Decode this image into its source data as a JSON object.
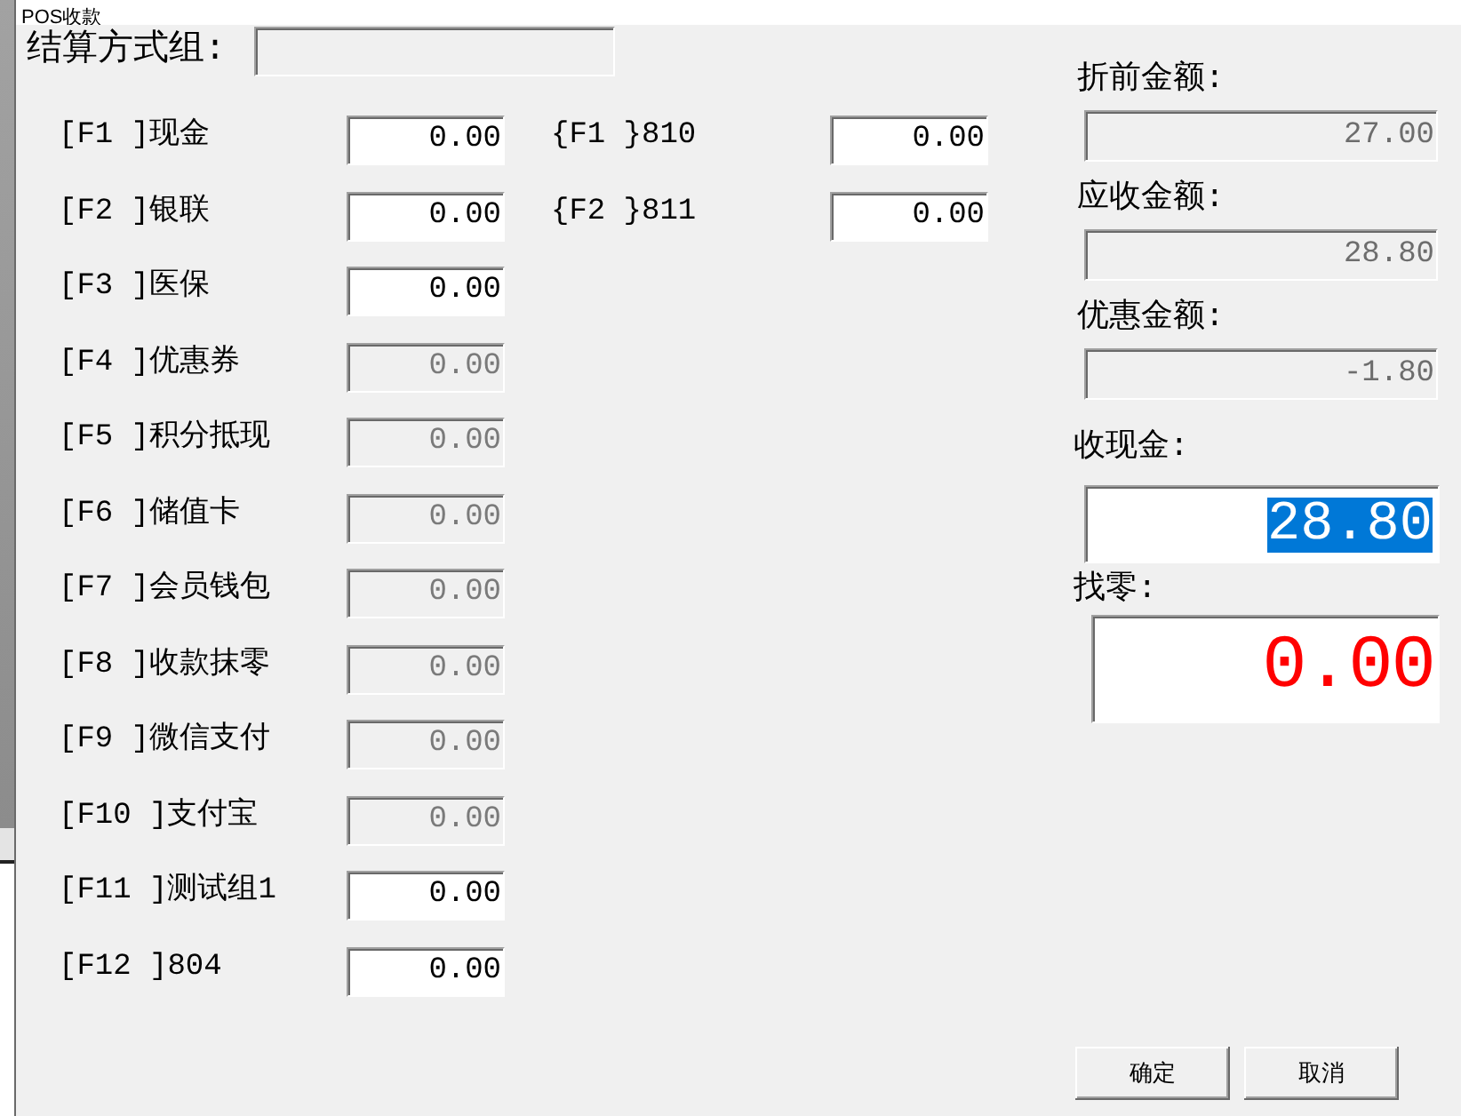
{
  "window": {
    "title": "POS收款"
  },
  "settlement_group": {
    "label": "结算方式组:",
    "disabled": true
  },
  "payment_methods": [
    {
      "label": "[F1 ]现金",
      "value": "0.00",
      "disabled": false
    },
    {
      "label": "[F2 ]银联",
      "value": "0.00",
      "disabled": false
    },
    {
      "label": "[F3 ]医保",
      "value": "0.00",
      "disabled": false
    },
    {
      "label": "[F4 ]优惠券",
      "value": "0.00",
      "disabled": true
    },
    {
      "label": "[F5 ]积分抵现",
      "value": "0.00",
      "disabled": true
    },
    {
      "label": "[F6 ]储值卡",
      "value": "0.00",
      "disabled": true
    },
    {
      "label": "[F7 ]会员钱包",
      "value": "0.00",
      "disabled": true
    },
    {
      "label": "[F8 ]收款抹零",
      "value": "0.00",
      "disabled": true
    },
    {
      "label": "[F9 ]微信支付",
      "value": "0.00",
      "disabled": true
    },
    {
      "label": "[F10 ]支付宝",
      "value": "0.00",
      "disabled": true
    },
    {
      "label": "[F11 ]测试组1",
      "value": "0.00",
      "disabled": false
    },
    {
      "label": "[F12 ]804",
      "value": "0.00",
      "disabled": false
    }
  ],
  "extra_payment_methods": [
    {
      "label": "{F1 }810",
      "value": "0.00",
      "disabled": false
    },
    {
      "label": "{F2 }811",
      "value": "0.00",
      "disabled": false
    }
  ],
  "summary": [
    {
      "kind": "amount",
      "label": "折前金额:",
      "value": "27.00",
      "disabled": true,
      "text_selected": false
    },
    {
      "kind": "amount",
      "label": "应收金额:",
      "value": "28.80",
      "disabled": true,
      "text_selected": false
    },
    {
      "kind": "amount",
      "label": "优惠金额:",
      "value": "-1.80",
      "disabled": true,
      "text_selected": false
    },
    {
      "kind": "cash",
      "label": "收现金:",
      "value": "28.80",
      "disabled": false,
      "text_selected": true
    },
    {
      "kind": "change",
      "label": "找零:",
      "value": "0.00",
      "disabled": false,
      "text_selected": false
    }
  ],
  "buttons": [
    "确定",
    "取消"
  ]
}
